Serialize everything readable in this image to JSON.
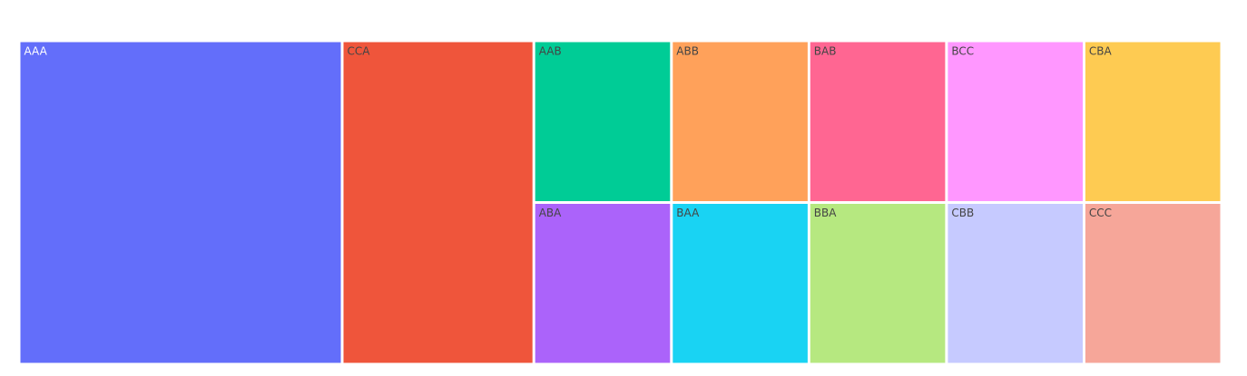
{
  "chart_data": {
    "type": "treemap",
    "tiles": [
      {
        "label": "AAA",
        "value": 6.39,
        "color": "#636efa",
        "text_color": "#ffffff"
      },
      {
        "label": "CCA",
        "value": 3.79,
        "color": "#ef553b",
        "text_color": "#444444"
      },
      {
        "label": "AAB",
        "value": 1.36,
        "color": "#00cc96",
        "text_color": "#444444"
      },
      {
        "label": "ABA",
        "value": 1.36,
        "color": "#ab63fa",
        "text_color": "#444444"
      },
      {
        "label": "ABB",
        "value": 1.36,
        "color": "#ffa15a",
        "text_color": "#444444"
      },
      {
        "label": "BAA",
        "value": 1.36,
        "color": "#19d3f3",
        "text_color": "#444444"
      },
      {
        "label": "BAB",
        "value": 1.36,
        "color": "#ff6692",
        "text_color": "#444444"
      },
      {
        "label": "BBA",
        "value": 1.36,
        "color": "#b6e880",
        "text_color": "#444444"
      },
      {
        "label": "BCC",
        "value": 1.36,
        "color": "#ff97ff",
        "text_color": "#444444"
      },
      {
        "label": "CBB",
        "value": 1.36,
        "color": "#c6caff",
        "text_color": "#444444"
      },
      {
        "label": "CBA",
        "value": 1.36,
        "color": "#fecb52",
        "text_color": "#444444"
      },
      {
        "label": "CCC",
        "value": 1.36,
        "color": "#f6a699",
        "text_color": "#444444"
      }
    ]
  }
}
